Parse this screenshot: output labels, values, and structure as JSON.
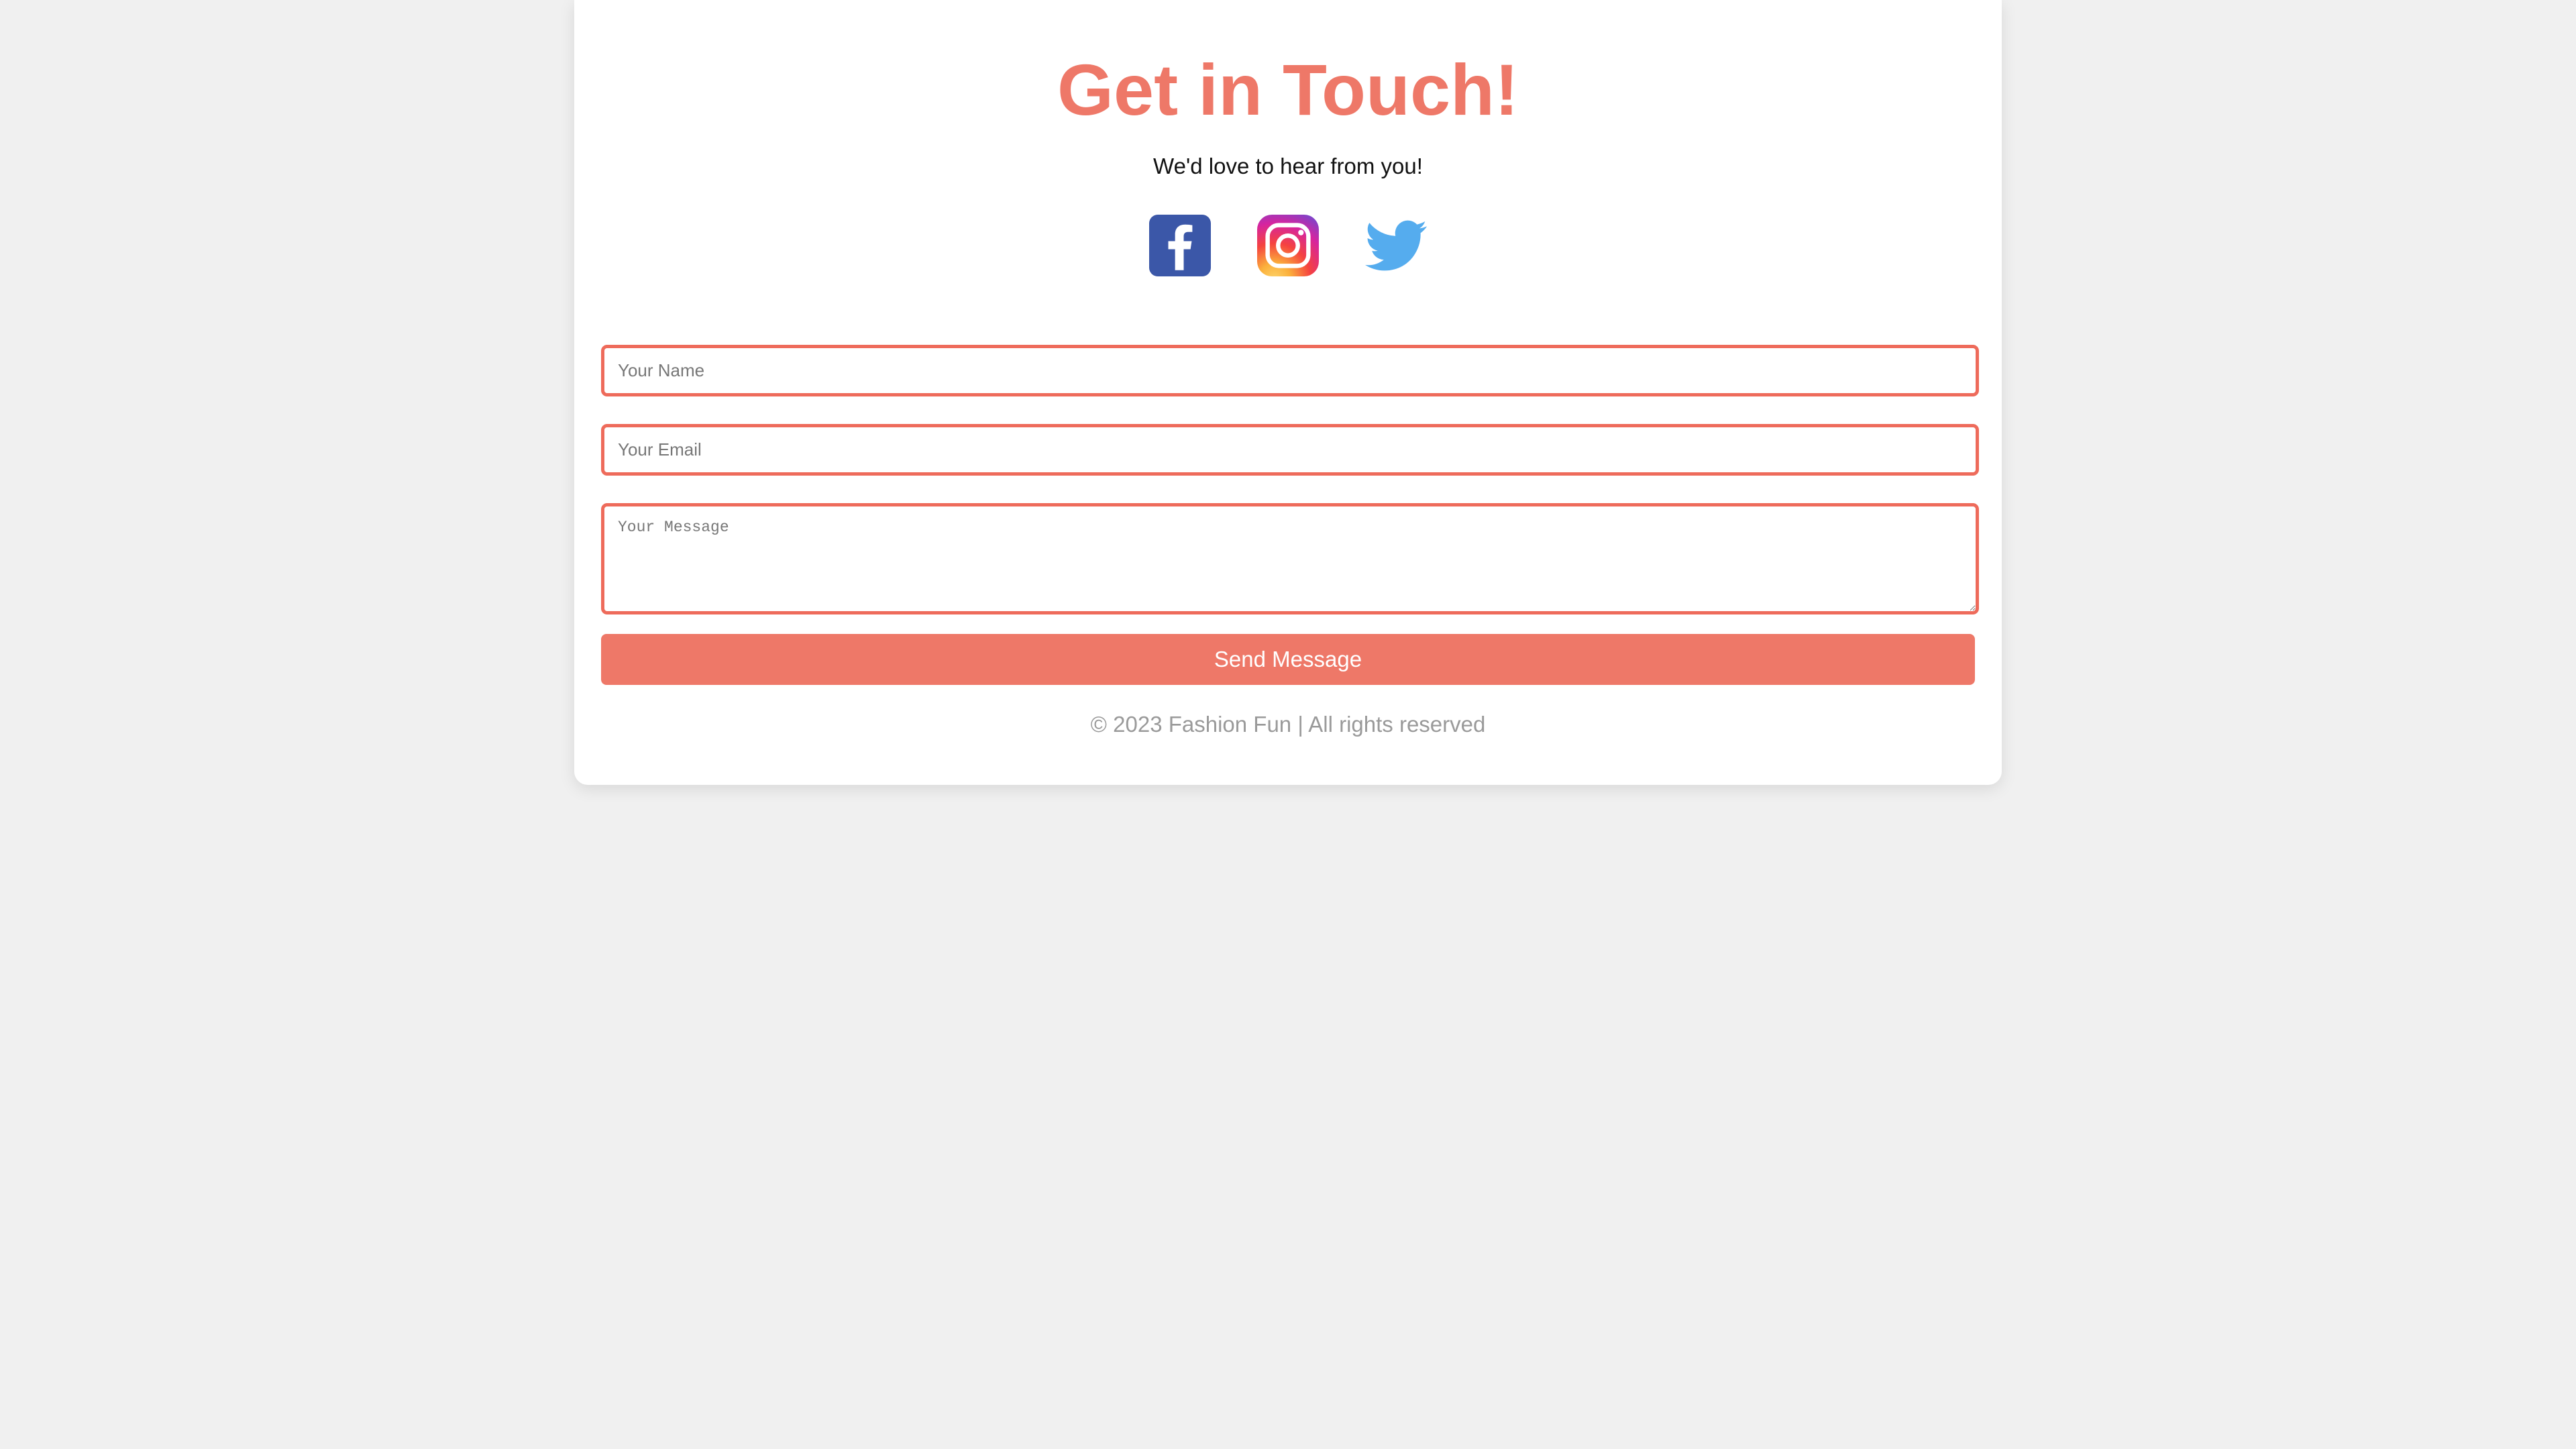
{
  "colors": {
    "accent": "#ee7868",
    "field_border": "#ee6b5b",
    "page_background": "#f0f0f0",
    "card_background": "#ffffff",
    "footer_text": "#9a9a9a",
    "facebook_blue": "#3b57a8",
    "twitter_blue": "#55acee"
  },
  "header": {
    "title": "Get in Touch!",
    "subtitle": "We'd love to hear from you!"
  },
  "social": [
    {
      "icon": "facebook-icon"
    },
    {
      "icon": "instagram-icon"
    },
    {
      "icon": "twitter-icon"
    }
  ],
  "form": {
    "name": {
      "placeholder": "Your Name",
      "value": ""
    },
    "email": {
      "placeholder": "Your Email",
      "value": ""
    },
    "message": {
      "placeholder": "Your Message",
      "value": ""
    },
    "submit_label": "Send Message"
  },
  "footer": {
    "text": "© 2023 Fashion Fun | All rights reserved"
  }
}
